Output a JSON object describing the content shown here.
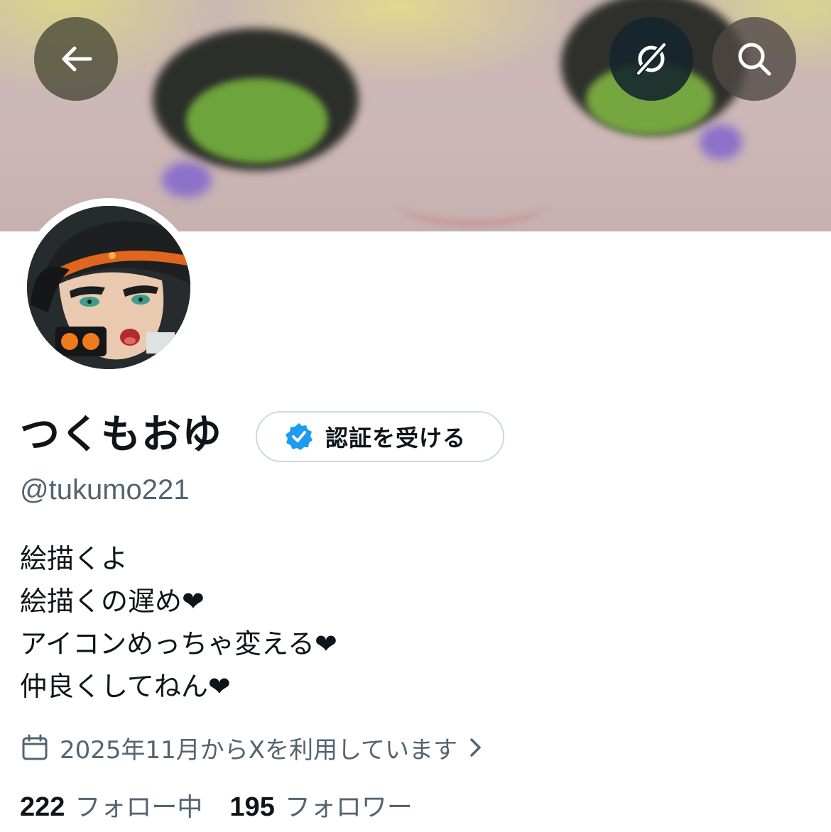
{
  "banner": {
    "colors": {
      "face": "#cdb8b7",
      "hair": "#dcd48a",
      "iris": "#6ea43c",
      "blush": "#8c71c9"
    }
  },
  "nav": {
    "back_icon": "arrow-left-icon",
    "grok_icon": "grok-icon",
    "search_icon": "search-icon"
  },
  "profile": {
    "display_name": "つくもおゆ",
    "handle": "@tukumo221",
    "verify_button_label": "認証を受ける",
    "bio_lines": [
      "絵描くよ",
      "絵描くの遅め❤",
      "アイコンめっちゃ変える❤",
      "仲良くしてねん❤"
    ],
    "joined_text": "2025年11月からXを利用しています",
    "following_count": "222",
    "following_label": "フォロー中",
    "followers_count": "195",
    "followers_label": "フォロワー"
  },
  "colors": {
    "primary_text": "#0f1419",
    "secondary_text": "#536471",
    "verified_blue": "#1d9bf0",
    "border": "#cfd9de"
  }
}
